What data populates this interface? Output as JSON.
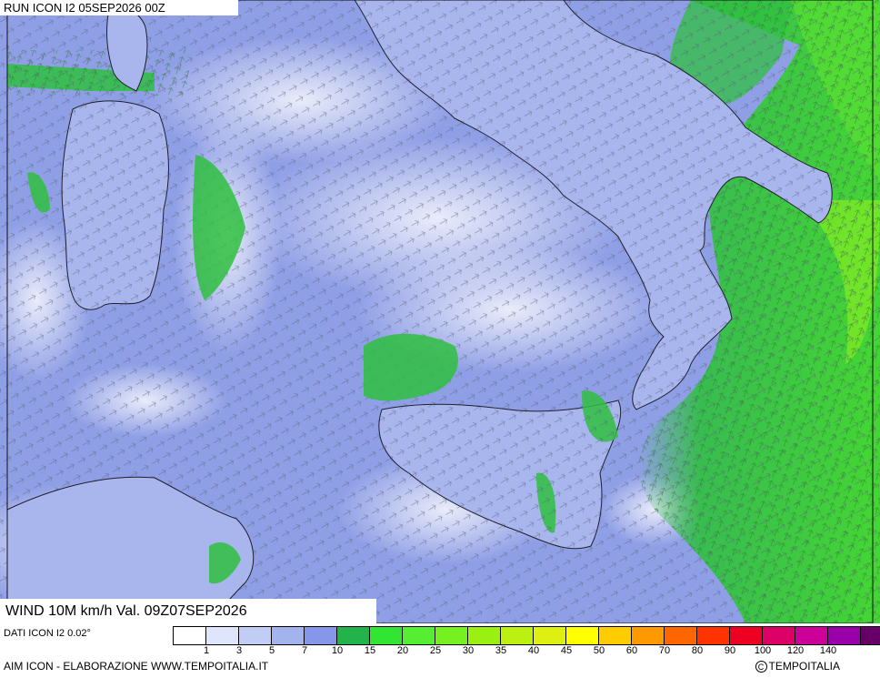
{
  "header": {
    "run_label": "RUN ICON I2 05SEP2026 00Z"
  },
  "map": {
    "field": "wind 10m speed",
    "background_color": "#8fa0e8",
    "land_outline_color": "#222222",
    "arrow_color": "#555566"
  },
  "valid_label": "WIND 10M km/h Val. 09Z07SEP2026",
  "footer": {
    "dati_label": "DATI ICON I2 0.02°",
    "aim_label": "AIM ICON - ELABORAZIONE WWW.TEMPOITALIA.IT",
    "copyright_symbol": "C",
    "copyright_label": "TEMPOITALIA"
  },
  "legend": {
    "colors": [
      "#ffffff",
      "#dfe6fb",
      "#c2cdf5",
      "#a3b3ee",
      "#8696e8",
      "#22b34a",
      "#33e533",
      "#55ee33",
      "#77f022",
      "#99f011",
      "#bbf011",
      "#ddf011",
      "#ffff00",
      "#ffcc00",
      "#ff9900",
      "#ff6600",
      "#ff3300",
      "#ee0022",
      "#dd0066",
      "#cc0099",
      "#9900aa",
      "#660066"
    ],
    "tick_labels": [
      "1",
      "3",
      "5",
      "7",
      "10",
      "15",
      "20",
      "25",
      "30",
      "35",
      "40",
      "45",
      "50",
      "60",
      "70",
      "80",
      "90",
      "100",
      "120",
      "140"
    ]
  }
}
